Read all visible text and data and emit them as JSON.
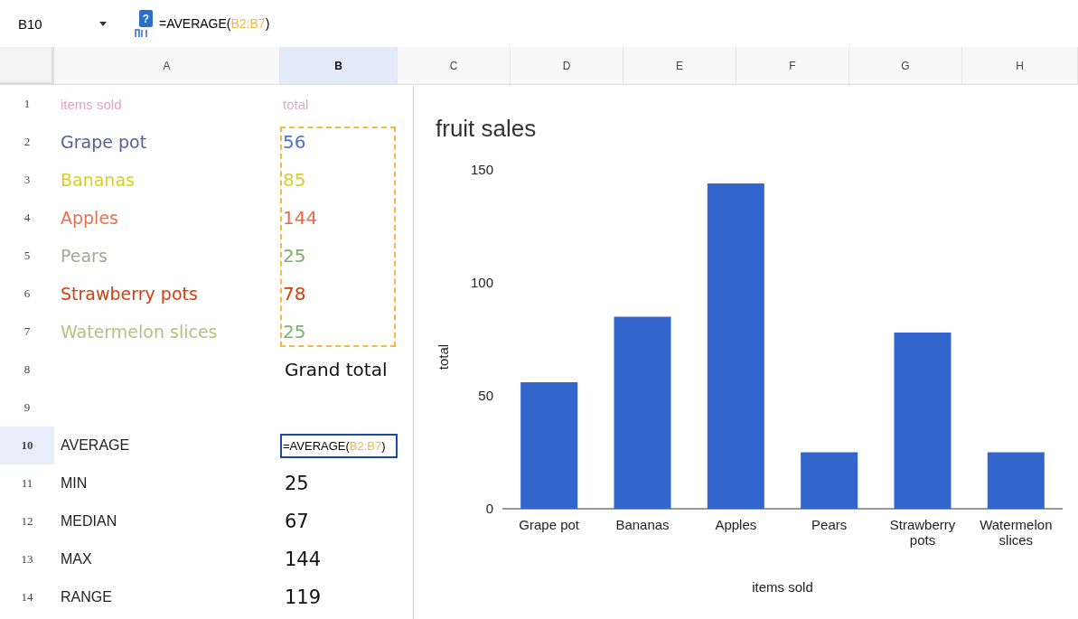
{
  "formula_bar": {
    "cell_ref": "B10",
    "help_mark": "?",
    "formula": {
      "prefix": "=AVERAGE(",
      "range": {
        "text": "B2:B7",
        "color": "#f5b942"
      },
      "suffix": ")"
    }
  },
  "columns": [
    {
      "label": "A",
      "selected": false
    },
    {
      "label": "B",
      "selected": true
    },
    {
      "label": "C",
      "selected": false
    },
    {
      "label": "D",
      "selected": false
    },
    {
      "label": "E",
      "selected": false
    },
    {
      "label": "F",
      "selected": false
    },
    {
      "label": "G",
      "selected": false
    },
    {
      "label": "H",
      "selected": false
    }
  ],
  "rows": [
    {
      "num": "1",
      "selected": false,
      "kind": "header",
      "label": {
        "text": "items sold",
        "color": "#e3a3c4"
      },
      "value": {
        "text": "total",
        "color": "#d8b0c4"
      }
    },
    {
      "num": "2",
      "selected": false,
      "kind": "item",
      "label": {
        "text": "Grape pot",
        "color": "#55609a"
      },
      "value": {
        "text": "56",
        "color": "#4f6fd6"
      }
    },
    {
      "num": "3",
      "selected": false,
      "kind": "item",
      "label": {
        "text": "Bananas",
        "color": "#d8d020"
      },
      "value": {
        "text": "85",
        "color": "#d8cc30"
      }
    },
    {
      "num": "4",
      "selected": false,
      "kind": "item",
      "label": {
        "text": "Apples",
        "color": "#e7704f"
      },
      "value": {
        "text": "144",
        "color": "#ec6a4a"
      }
    },
    {
      "num": "5",
      "selected": false,
      "kind": "item",
      "label": {
        "text": "Pears",
        "color": "#a3a894"
      },
      "value": {
        "text": "25",
        "color": "#7fae6a"
      }
    },
    {
      "num": "6",
      "selected": false,
      "kind": "item",
      "label": {
        "text": "Strawberry pots",
        "color": "#d2400f"
      },
      "value": {
        "text": "78",
        "color": "#d83a08"
      }
    },
    {
      "num": "7",
      "selected": false,
      "kind": "item",
      "label": {
        "text": "Watermelon slices",
        "color": "#b4c084"
      },
      "value": {
        "text": "25",
        "color": "#7fae6a"
      }
    },
    {
      "num": "8",
      "selected": false,
      "kind": "total",
      "value": {
        "text": "Grand total"
      }
    },
    {
      "num": "9",
      "selected": false,
      "kind": "blank"
    },
    {
      "num": "10",
      "selected": true,
      "kind": "formula",
      "label": {
        "text": "AVERAGE"
      },
      "formula": {
        "prefix": "=AVERAGE(",
        "range": {
          "text": "B2:B7",
          "color": "#f5b942"
        },
        "suffix": ")"
      }
    },
    {
      "num": "11",
      "selected": false,
      "kind": "stat",
      "label": {
        "text": "MIN"
      },
      "value": {
        "text": "25"
      }
    },
    {
      "num": "12",
      "selected": false,
      "kind": "stat",
      "label": {
        "text": "MEDIAN"
      },
      "value": {
        "text": "67"
      }
    },
    {
      "num": "13",
      "selected": false,
      "kind": "stat",
      "label": {
        "text": "MAX"
      },
      "value": {
        "text": "144"
      }
    },
    {
      "num": "14",
      "selected": false,
      "kind": "stat",
      "label": {
        "text": "RANGE"
      },
      "value": {
        "text": "119"
      }
    }
  ],
  "chart_data": {
    "type": "bar",
    "title": "fruit sales",
    "xlabel": "items sold",
    "ylabel": "total",
    "categories": [
      "Grape pot",
      "Bananas",
      "Apples",
      "Pears",
      "Strawberry pots",
      "Watermelon slices"
    ],
    "series": [
      {
        "color": "#3366cc",
        "values": [
          56,
          85,
          144,
          25,
          78,
          25
        ]
      }
    ],
    "ylim": [
      0,
      150
    ],
    "yticks": [
      0,
      50,
      100,
      150
    ]
  }
}
